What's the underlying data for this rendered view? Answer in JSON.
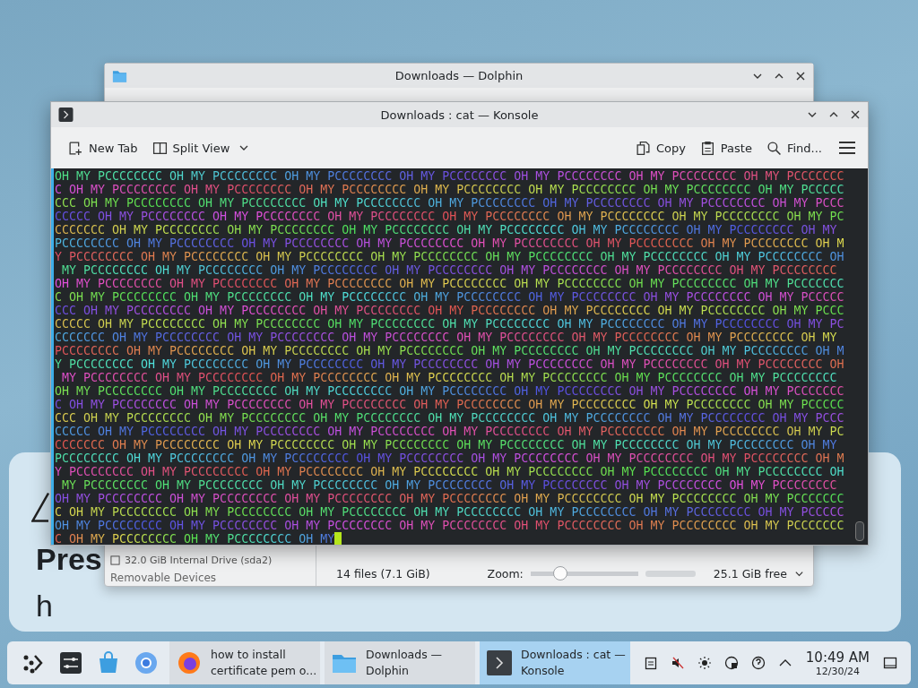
{
  "background_page": {
    "heading": "Pres",
    "heading_2": "h"
  },
  "dolphin": {
    "title": "Downloads — Dolphin",
    "places_item": "32.0 GiB Internal Drive (sda2)",
    "places_section": "Removable Devices",
    "status": "14 files (7.1 GiB)",
    "zoom_label": "Zoom:",
    "zoom": {
      "level": 0.28
    },
    "free_space": "25.1 GiB free"
  },
  "konsole": {
    "title": "Downloads : cat — Konsole",
    "toolbar": [
      {
        "label": "New Tab",
        "kind": "new-tab"
      },
      {
        "label": "Split View",
        "kind": "split-view"
      },
      {
        "label": "Copy",
        "kind": "copy"
      },
      {
        "label": "Paste",
        "kind": "paste"
      },
      {
        "label": "Find...",
        "kind": "find"
      }
    ],
    "lines": [
      "OH MY PCCCCCCCC OH MY PCCCCCCCC OH MY PCCCCCCCC OH MY PCCCCCCCC OH MY PCCCCCCCC OH MY PCCCCCCCC OH MY PCCCCCCC",
      "C OH MY PCCCCCCCC OH MY PCCCCCCCC OH MY PCCCCCCCC OH MY PCCCCCCCC OH MY PCCCCCCCC OH MY PCCCCCCCC OH MY PCCCCC",
      "CCC OH MY PCCCCCCCC OH MY PCCCCCCCC OH MY PCCCCCCCC OH MY PCCCCCCCC OH MY PCCCCCCCC OH MY PCCCCCCCC OH MY PCCC",
      "CCCCC OH MY PCCCCCCCC OH MY PCCCCCCCC OH MY PCCCCCCCC OH MY PCCCCCCCC OH MY PCCCCCCCC OH MY PCCCCCCCC OH MY PC",
      "CCCCCCC OH MY PCCCCCCCC OH MY PCCCCCCCC OH MY PCCCCCCCC OH MY PCCCCCCCC OH MY PCCCCCCCC OH MY PCCCCCCCC OH MY",
      "PCCCCCCCC OH MY PCCCCCCCC OH MY PCCCCCCCC OH MY PCCCCCCCC OH MY PCCCCCCCC OH MY PCCCCCCCC OH MY PCCCCCCCC OH M",
      "Y PCCCCCCCC OH MY PCCCCCCCC OH MY PCCCCCCCC OH MY PCCCCCCCC OH MY PCCCCCCCC OH MY PCCCCCCCC OH MY PCCCCCCCC OH",
      " MY PCCCCCCCC OH MY PCCCCCCCC OH MY PCCCCCCCC OH MY PCCCCCCCC OH MY PCCCCCCCC OH MY PCCCCCCCC OH MY PCCCCCCCC",
      "OH MY PCCCCCCCC OH MY PCCCCCCCC OH MY PCCCCCCCC OH MY PCCCCCCCC OH MY PCCCCCCCC OH MY PCCCCCCCC OH MY PCCCCCCC",
      "C OH MY PCCCCCCCC OH MY PCCCCCCCC OH MY PCCCCCCCC OH MY PCCCCCCCC OH MY PCCCCCCCC OH MY PCCCCCCCC OH MY PCCCCC",
      "CCC OH MY PCCCCCCCC OH MY PCCCCCCCC OH MY PCCCCCCCC OH MY PCCCCCCCC OH MY PCCCCCCCC OH MY PCCCCCCCC OH MY PCCC",
      "CCCCC OH MY PCCCCCCCC OH MY PCCCCCCCC OH MY PCCCCCCCC OH MY PCCCCCCCC OH MY PCCCCCCCC OH MY PCCCCCCCC OH MY PC",
      "CCCCCCC OH MY PCCCCCCCC OH MY PCCCCCCCC OH MY PCCCCCCCC OH MY PCCCCCCCC OH MY PCCCCCCCC OH MY PCCCCCCCC OH MY",
      "PCCCCCCCC OH MY PCCCCCCCC OH MY PCCCCCCCC OH MY PCCCCCCCC OH MY PCCCCCCCC OH MY PCCCCCCCC OH MY PCCCCCCCC OH M",
      "Y PCCCCCCCC OH MY PCCCCCCCC OH MY PCCCCCCCC OH MY PCCCCCCCC OH MY PCCCCCCCC OH MY PCCCCCCCC OH MY PCCCCCCCC OH",
      " MY PCCCCCCCC OH MY PCCCCCCCC OH MY PCCCCCCCC OH MY PCCCCCCCC OH MY PCCCCCCCC OH MY PCCCCCCCC OH MY PCCCCCCCC",
      "OH MY PCCCCCCCC OH MY PCCCCCCCC OH MY PCCCCCCCC OH MY PCCCCCCCC OH MY PCCCCCCCC OH MY PCCCCCCCC OH MY PCCCCCCC",
      "C OH MY PCCCCCCCC OH MY PCCCCCCCC OH MY PCCCCCCCC OH MY PCCCCCCCC OH MY PCCCCCCCC OH MY PCCCCCCCC OH MY PCCCCC",
      "CCC OH MY PCCCCCCCC OH MY PCCCCCCCC OH MY PCCCCCCCC OH MY PCCCCCCCC OH MY PCCCCCCCC OH MY PCCCCCCCC OH MY PCCC",
      "CCCCC OH MY PCCCCCCCC OH MY PCCCCCCCC OH MY PCCCCCCCC OH MY PCCCCCCCC OH MY PCCCCCCCC OH MY PCCCCCCCC OH MY PC",
      "CCCCCCC OH MY PCCCCCCCC OH MY PCCCCCCCC OH MY PCCCCCCCC OH MY PCCCCCCCC OH MY PCCCCCCCC OH MY PCCCCCCCC OH MY",
      "PCCCCCCCC OH MY PCCCCCCCC OH MY PCCCCCCCC OH MY PCCCCCCCC OH MY PCCCCCCCC OH MY PCCCCCCCC OH MY PCCCCCCCC OH M",
      "Y PCCCCCCCC OH MY PCCCCCCCC OH MY PCCCCCCCC OH MY PCCCCCCCC OH MY PCCCCCCCC OH MY PCCCCCCCC OH MY PCCCCCCCC OH",
      " MY PCCCCCCCC OH MY PCCCCCCCC OH MY PCCCCCCCC OH MY PCCCCCCCC OH MY PCCCCCCCC OH MY PCCCCCCCC OH MY PCCCCCCCC",
      "OH MY PCCCCCCCC OH MY PCCCCCCCC OH MY PCCCCCCCC OH MY PCCCCCCCC OH MY PCCCCCCCC OH MY PCCCCCCCC OH MY PCCCCCCC",
      "C OH MY PCCCCCCCC OH MY PCCCCCCCC OH MY PCCCCCCCC OH MY PCCCCCCCC OH MY PCCCCCCCC OH MY PCCCCCCCC OH MY PCCCCC",
      "OH MY PCCCCCCCC OH MY PCCCCCCCC OH MY PCCCCCCCC OH MY PCCCCCCCC OH MY PCCCCCCCC OH MY PCCCCCCCC OH MY PCCCCCCC",
      "C OH MY PCCCCCCCC OH MY PCCCCCCCC OH MY"
    ]
  },
  "taskbar": {
    "tasks": [
      {
        "kind": "browser",
        "lines": [
          "how to install",
          "certificate pem o..."
        ],
        "selected": false
      },
      {
        "kind": "files",
        "lines": [
          "Downloads —",
          "Dolphin"
        ],
        "selected": false
      },
      {
        "kind": "terminal",
        "lines": [
          "Downloads : cat —",
          "Konsole"
        ],
        "selected": true
      }
    ],
    "clock": {
      "time": "10:49 AM",
      "date": "12/30/24"
    }
  }
}
